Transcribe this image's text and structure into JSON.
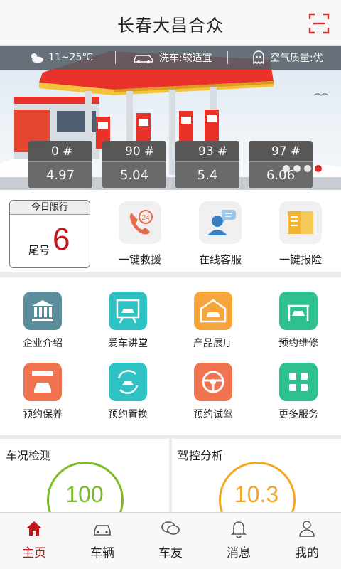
{
  "header": {
    "title": "长春大昌合众"
  },
  "info_bar": {
    "temperature": "11~25℃",
    "car_wash": "洗车:较适宜",
    "air_quality": "空气质量:优"
  },
  "fuel_prices": [
    {
      "grade": "0 #",
      "price": "4.97"
    },
    {
      "grade": "90 #",
      "price": "5.04"
    },
    {
      "grade": "93 #",
      "price": "5.4"
    },
    {
      "grade": "97 #",
      "price": "6.06"
    }
  ],
  "carousel": {
    "pages": 4,
    "active": 4
  },
  "limit": {
    "title": "今日限行",
    "label": "尾号",
    "number": "6"
  },
  "quick_actions": [
    {
      "label": "一键救援",
      "icon": "rescue-24-icon"
    },
    {
      "label": "在线客服",
      "icon": "customer-service-icon"
    },
    {
      "label": "一键报险",
      "icon": "insurance-report-icon"
    }
  ],
  "services": [
    {
      "label": "企业介绍",
      "icon": "company-icon",
      "color": "#5b8d9b"
    },
    {
      "label": "爱车讲堂",
      "icon": "car-lecture-icon",
      "color": "#2fc2c4"
    },
    {
      "label": "产品展厅",
      "icon": "showroom-icon",
      "color": "#f5a53a"
    },
    {
      "label": "预约维修",
      "icon": "repair-icon",
      "color": "#2fc08f"
    },
    {
      "label": "预约保养",
      "icon": "maintenance-icon",
      "color": "#f27350"
    },
    {
      "label": "预约置换",
      "icon": "trade-in-icon",
      "color": "#2fc2c4"
    },
    {
      "label": "预约试驾",
      "icon": "test-drive-icon",
      "color": "#f27350"
    },
    {
      "label": "更多服务",
      "icon": "more-services-icon",
      "color": "#2fc08f"
    }
  ],
  "analysis": [
    {
      "title": "车况检测",
      "value": "100",
      "color": "#7dbb2a"
    },
    {
      "title": "驾控分析",
      "value": "10.3",
      "color": "#f5a623"
    }
  ],
  "bottom_nav": [
    {
      "label": "主页",
      "icon": "home-icon",
      "active": true
    },
    {
      "label": "车辆",
      "icon": "car-icon",
      "active": false
    },
    {
      "label": "车友",
      "icon": "chat-icon",
      "active": false
    },
    {
      "label": "消息",
      "icon": "bell-icon",
      "active": false
    },
    {
      "label": "我的",
      "icon": "user-icon",
      "active": false
    }
  ],
  "colors": {
    "brand_red": "#c3171b",
    "accent_red": "#e02b2b"
  }
}
